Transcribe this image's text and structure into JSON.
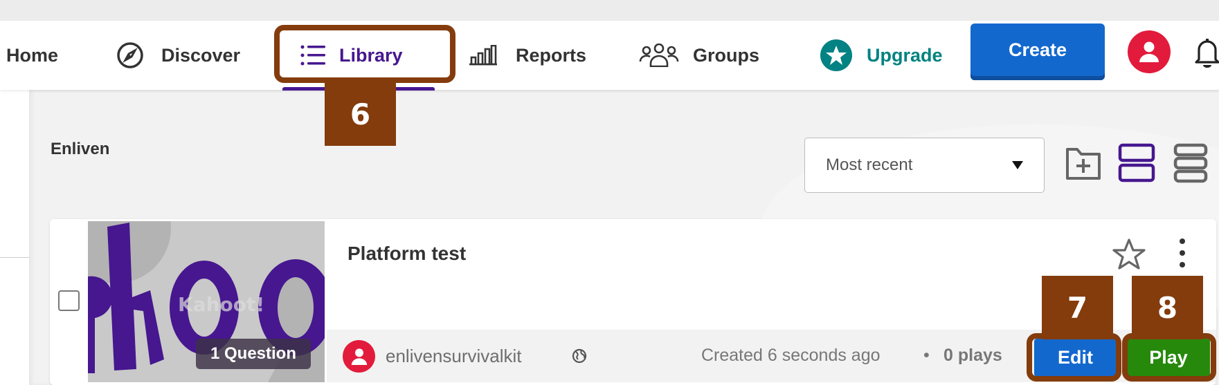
{
  "nav": {
    "items": [
      {
        "label": "Home",
        "icon": "home"
      },
      {
        "label": "Discover",
        "icon": "compass-icon"
      },
      {
        "label": "Library",
        "icon": "list-icon",
        "active": true
      },
      {
        "label": "Reports",
        "icon": "bar-chart-icon"
      },
      {
        "label": "Groups",
        "icon": "people-icon"
      }
    ],
    "upgrade_label": "Upgrade",
    "create_label": "Create",
    "colors": {
      "active": "#46178f",
      "upgrade": "#028282",
      "create": "#1368ce",
      "avatar": "#e21b3c"
    }
  },
  "library": {
    "folder_title": "Enliven",
    "sort": {
      "selected": "Most recent"
    }
  },
  "kahoot_card": {
    "title": "Platform test",
    "question_count": "1 Question",
    "owner": "enlivensurvivalkit",
    "created": "Created 6 seconds ago",
    "separator": "•",
    "plays": "0 plays",
    "edit_label": "Edit",
    "play_label": "Play",
    "colors": {
      "edit": "#1368ce",
      "play": "#26890c"
    }
  },
  "annotations": [
    {
      "number": "6",
      "target": "Library"
    },
    {
      "number": "7",
      "target": "Edit"
    },
    {
      "number": "8",
      "target": "Play"
    }
  ]
}
